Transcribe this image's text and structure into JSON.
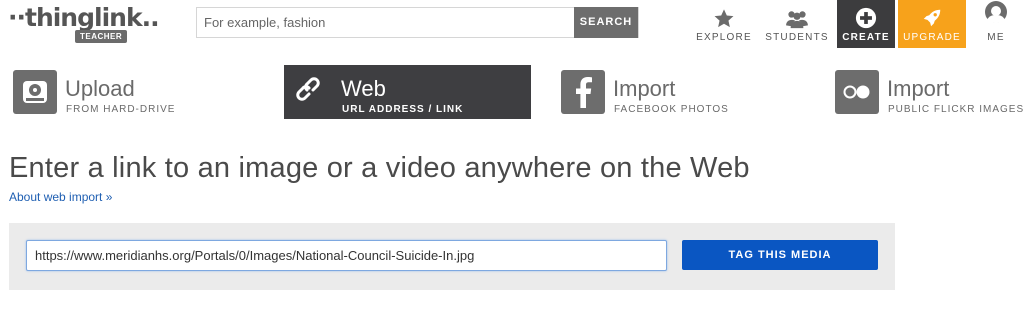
{
  "header": {
    "logo_text": "··thinglink..",
    "logo_badge": "TEACHER",
    "search": {
      "placeholder": "For example, fashion",
      "value": "",
      "button_label": "SEARCH"
    },
    "nav": {
      "explore": {
        "label": "EXPLORE",
        "icon": "star-icon"
      },
      "students": {
        "label": "STUDENTS",
        "icon": "users-icon"
      },
      "create": {
        "label": "CREATE",
        "icon": "plus-circle-icon"
      },
      "upgrade": {
        "label": "UPGRADE",
        "icon": "rocket-icon"
      },
      "me": {
        "label": "ME",
        "icon": "user-avatar-icon"
      }
    }
  },
  "source_tabs": {
    "upload": {
      "title": "Upload",
      "subtitle": "FROM HARD-DRIVE",
      "icon": "hard-drive-icon"
    },
    "web": {
      "title": "Web",
      "subtitle": "URL ADDRESS / LINK",
      "icon": "link-icon",
      "selected": true
    },
    "facebook": {
      "title": "Import",
      "subtitle": "FACEBOOK PHOTOS",
      "icon": "facebook-icon"
    },
    "flickr": {
      "title": "Import",
      "subtitle": "PUBLIC FLICKR IMAGES",
      "icon": "flickr-icon"
    }
  },
  "main": {
    "heading": "Enter a link to an image or a video anywhere on the Web",
    "about_link": "About web import »",
    "url_value": "https://www.meridianhs.org/Portals/0/Images/National-Council-Suicide-In.jpg",
    "submit_label": "TAG THIS MEDIA"
  },
  "colors": {
    "selected_tab": "#3e3e41",
    "create": "#3c3c3e",
    "upgrade": "#f7a21b",
    "primary_button": "#0a56c2",
    "link": "#1f5fb2"
  }
}
